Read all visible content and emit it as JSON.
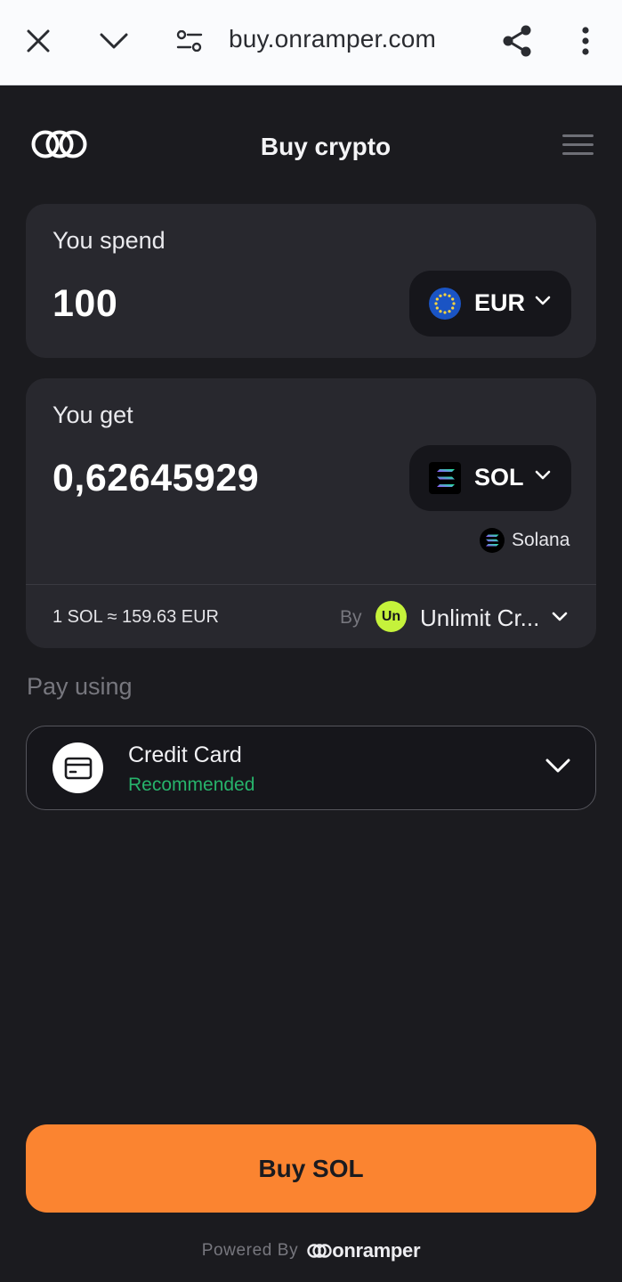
{
  "browser": {
    "url": "buy.onramper.com",
    "icons": [
      "close-icon",
      "chevron-down-icon",
      "site-settings-icon",
      "share-icon",
      "more-vert-icon"
    ]
  },
  "header": {
    "title": "Buy crypto",
    "logo_icon": "onramper-logo-icon",
    "menu_icon": "hamburger-menu-icon"
  },
  "spend": {
    "label": "You spend",
    "amount": "100",
    "currency": "EUR",
    "currency_icon": "eu-flag-icon"
  },
  "receive": {
    "label": "You get",
    "amount": "0,62645929",
    "token": "SOL",
    "token_icon": "solana-icon",
    "network": "Solana"
  },
  "quote": {
    "rate": "1 SOL ≈ 159.63 EUR",
    "by": "By",
    "provider_initials": "Un",
    "provider": "Unlimit Cr..."
  },
  "payment": {
    "section_label": "Pay using",
    "method": "Credit Card",
    "tag": "Recommended",
    "method_icon": "credit-card-icon"
  },
  "cta": {
    "label": "Buy SOL"
  },
  "footer": {
    "powered_by": "Powered By",
    "brand": "onramper"
  },
  "colors": {
    "background": "#1b1b1f",
    "card": "#28282e",
    "accent": "#fb8430",
    "recommended": "#27b36b",
    "provider_badge": "#c5f23b"
  }
}
